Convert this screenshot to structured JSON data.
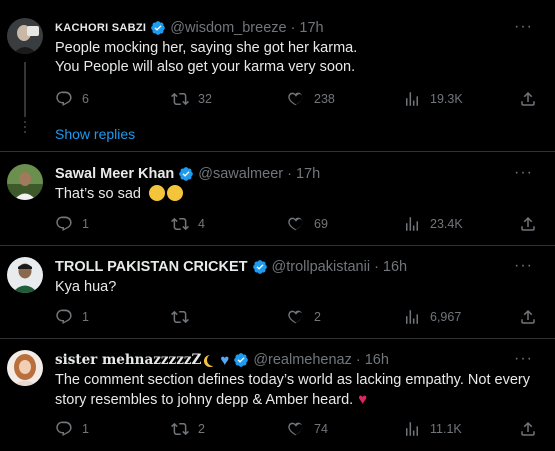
{
  "tweets": [
    {
      "name": "KACHORI SABZI",
      "handle": "@wisdom_breeze",
      "time": "17h",
      "text_lines": [
        "People mocking her, saying she got her karma.",
        "You People will also get your karma very soon."
      ],
      "replies": "6",
      "retweets": "32",
      "likes": "238",
      "views": "19.3K",
      "show_replies": "Show replies"
    },
    {
      "name": "Sawal Meer Khan",
      "handle": "@sawalmeer",
      "time": "17h",
      "text": "That’s so sad",
      "replies": "1",
      "retweets": "4",
      "likes": "69",
      "views": "23.4K"
    },
    {
      "name": "TROLL PAKISTAN CRICKET",
      "handle": "@trollpakistanii",
      "time": "16h",
      "text": "Kya hua?",
      "replies": "1",
      "retweets": "",
      "likes": "2",
      "views": "6,967"
    },
    {
      "name": "sister mehnazzzzzZ",
      "handle": "@realmehenaz",
      "time": "16h",
      "text_lines": [
        "The comment section defines today’s world as lacking empathy. Not every",
        "story resembles to johny depp &  Amber heard."
      ],
      "replies": "1",
      "retweets": "2",
      "likes": "74",
      "views": "11.1K"
    }
  ],
  "separator": "·",
  "more_glyph": "···",
  "icons": [
    "verified-badge-icon",
    "reply-icon",
    "retweet-icon",
    "like-icon",
    "views-icon",
    "share-icon",
    "more-icon"
  ],
  "colors": {
    "accent": "#1d9bf0",
    "muted": "#71767b",
    "text": "#e7e9ea",
    "divider": "#2f3336"
  }
}
